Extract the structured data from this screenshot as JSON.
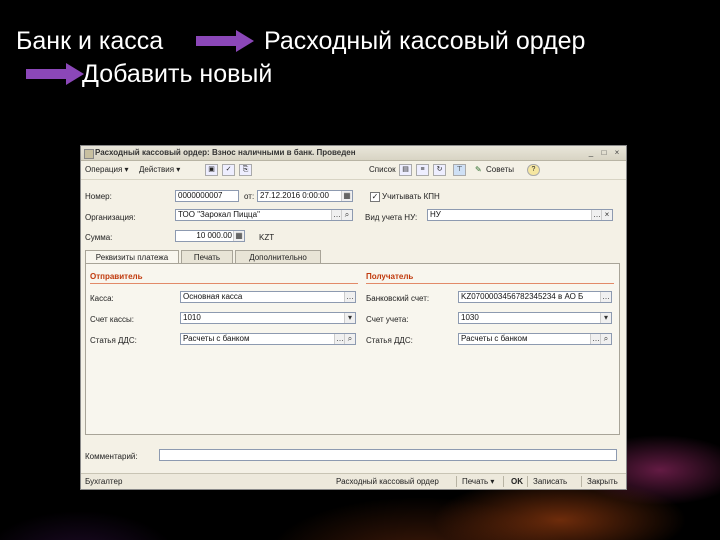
{
  "header": {
    "line1_left": "Банк и касса",
    "line1_right": "Расходный кассовый ордер",
    "line2": "Добавить новый"
  },
  "colors": {
    "arrow": "#8b47b8",
    "section_title": "#c0390c"
  },
  "window": {
    "title": "Расходный кассовый ордер: Взнос наличными в банк. Проведен",
    "buttons": [
      "_",
      "□",
      "×"
    ]
  },
  "toolbar": {
    "operation": "Операция ▾",
    "actions": "Действия ▾",
    "list": "Список",
    "advice": "Советы",
    "icons": [
      "save-icon",
      "post-icon",
      "copy-icon",
      "doc-icon",
      "structure-icon",
      "filter-icon",
      "help-icon"
    ]
  },
  "form": {
    "number_label": "Номер:",
    "number_value": "0000000007",
    "from_label": "от:",
    "date_value": "27.12.2016 0:00:00",
    "kudir_label": "Учитывать КПН",
    "org_label": "Организация:",
    "org_value": "ТОО \"Зарокал Пицца\"",
    "ndkp_label": "Вид учета НУ:",
    "ndkp_value": "НУ",
    "sum_label": "Сумма:",
    "sum_value": "10 000.00",
    "currency": "KZT"
  },
  "tabs": [
    "Реквизиты платежа",
    "Печать",
    "Дополнительно"
  ],
  "sender": {
    "title": "Отправитель",
    "cash_label": "Касса:",
    "cash_value": "Основная касса",
    "account_label": "Счет кассы:",
    "account_value": "1010",
    "dds_label": "Статья ДДС:",
    "dds_value": "Расчеты с банком"
  },
  "receiver": {
    "title": "Получатель",
    "bank_label": "Банковский счет:",
    "bank_value": "KZ0700003456782345234 в АО Б",
    "account_label": "Счет учета:",
    "account_value": "1030",
    "dds_label": "Статья ДДС:",
    "dds_value": "Расчеты с банком"
  },
  "comment_label": "Комментарий:",
  "footer": {
    "accountant": "Бухгалтер",
    "print_form": "Расходный кассовый ордер",
    "print": "Печать ▾",
    "ok": "OK",
    "save": "Записать",
    "close": "Закрыть"
  }
}
